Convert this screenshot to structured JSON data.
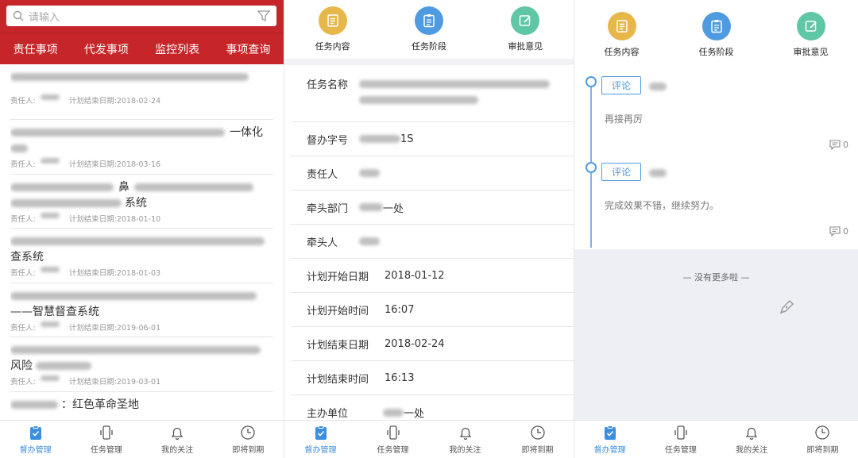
{
  "list_panel": {
    "search_placeholder": "请输入",
    "tabs": [
      "责任事项",
      "代发事项",
      "监控列表",
      "事项查询"
    ],
    "items": [
      {
        "title_tail": "",
        "owner_label": "责任人:",
        "due": "计划结束日期:2018-02-24"
      },
      {
        "title_tail": "一体化",
        "owner_label": "责任人:",
        "due": "计划结束日期:2018-03-16"
      },
      {
        "title_tail": "鼻",
        "title_tail2": "系统",
        "owner_label": "责任人:",
        "due": "计划结束日期:2018-01-10"
      },
      {
        "title_tail": "查系统",
        "owner_label": "责任人:",
        "due": "计划结束日期:2018-01-03"
      },
      {
        "title_tail": "——智慧督查系统",
        "owner_label": "责任人:",
        "due": "计划结束日期:2019-06-01"
      },
      {
        "title_tail": "风险",
        "owner_label": "责任人:",
        "due": "计划结束日期:2019-03-01"
      },
      {
        "title_tail": "：红色革命圣地",
        "owner_label": "",
        "due": ""
      }
    ]
  },
  "top_icons": [
    "任务内容",
    "任务阶段",
    "审批意见"
  ],
  "form": {
    "task_name_label": "任务名称",
    "doc_no_label": "督办字号",
    "doc_no_value": "1S",
    "owner_label": "责任人",
    "dept_label": "牵头部门",
    "dept_value": "一处",
    "lead_label": "牵头人",
    "plan_start_date_label": "计划开始日期",
    "plan_start_date": "2018-01-12",
    "plan_start_time_label": "计划开始时间",
    "plan_start_time": "16:07",
    "plan_end_date_label": "计划结束日期",
    "plan_end_date": "2018-02-24",
    "plan_end_time_label": "计划结束时间",
    "plan_end_time": "16:13",
    "host_unit_label": "主办单位",
    "host_unit_value": "一处"
  },
  "comments": {
    "button_label": "评论",
    "entries": [
      {
        "text": "再接再厉",
        "count": "0"
      },
      {
        "text": "完成效果不错，继续努力。",
        "count": "0"
      }
    ],
    "no_more": "— 没有更多啦 —"
  },
  "tabbar": [
    "督办管理",
    "任务管理",
    "我的关注",
    "即将到期"
  ],
  "colors": {
    "brand_red": "#c6262a",
    "accent_blue": "#3b8ee0"
  }
}
